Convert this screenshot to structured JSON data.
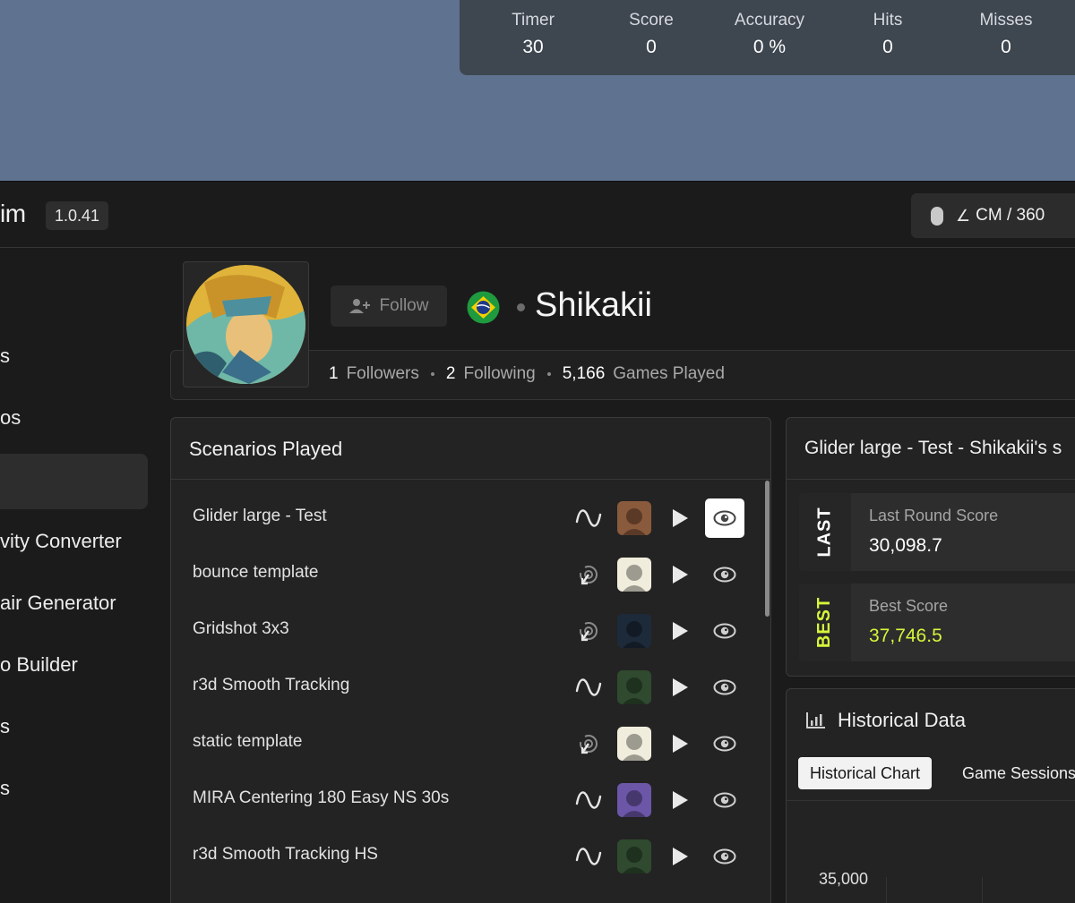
{
  "hud": {
    "stats": [
      {
        "label": "Timer",
        "value": "30"
      },
      {
        "label": "Score",
        "value": "0"
      },
      {
        "label": "Accuracy",
        "value": "0 %"
      },
      {
        "label": "Hits",
        "value": "0"
      },
      {
        "label": "Misses",
        "value": "0"
      }
    ]
  },
  "header": {
    "app_name_partial": "im",
    "version": "1.0.41",
    "sensitivity_label": "CM / 360"
  },
  "sidebar": {
    "items": [
      {
        "label": "s"
      },
      {
        "label": "os"
      },
      {
        "label": ""
      },
      {
        "label": "vity Converter"
      },
      {
        "label": "air Generator"
      },
      {
        "label": "o Builder"
      },
      {
        "label": "s"
      },
      {
        "label": "s"
      }
    ]
  },
  "profile": {
    "follow_label": "Follow",
    "username": "Shikakii",
    "followers_count": "1",
    "followers_label": "Followers",
    "following_count": "2",
    "following_label": "Following",
    "games_count": "5,166",
    "games_label": "Games Played"
  },
  "scenarios": {
    "title": "Scenarios Played",
    "rows": [
      {
        "name": "Glider large - Test",
        "mode": "tracking",
        "eye_active": true
      },
      {
        "name": "bounce template",
        "mode": "clicking",
        "eye_active": false
      },
      {
        "name": "Gridshot 3x3",
        "mode": "clicking",
        "eye_active": false
      },
      {
        "name": "r3d Smooth Tracking",
        "mode": "tracking",
        "eye_active": false
      },
      {
        "name": "static template",
        "mode": "clicking",
        "eye_active": false
      },
      {
        "name": "MIRA Centering 180 Easy NS 30s",
        "mode": "tracking",
        "eye_active": false
      },
      {
        "name": "r3d Smooth Tracking HS",
        "mode": "tracking",
        "eye_active": false
      }
    ]
  },
  "score_panel": {
    "title": "Glider large - Test - Shikakii's s",
    "last": {
      "tag": "LAST",
      "label": "Last Round Score",
      "value": "30,098.7"
    },
    "best": {
      "tag": "BEST",
      "label": "Best Score",
      "value": "37,746.5"
    }
  },
  "historical": {
    "title": "Historical Data",
    "tabs": [
      "Historical Chart",
      "Game Sessions"
    ],
    "y_tick": "35,000"
  },
  "colors": {
    "best_accent": "#d6f53b",
    "game_bg": "#5f7390"
  }
}
